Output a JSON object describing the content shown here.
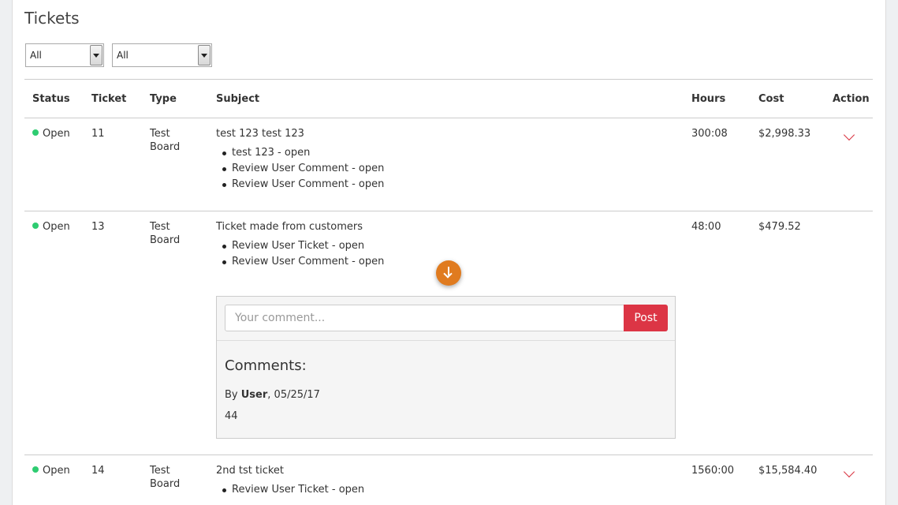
{
  "page_title": "Tickets",
  "filters": [
    {
      "value": "All"
    },
    {
      "value": "All"
    }
  ],
  "table": {
    "headers": [
      "Status",
      "Ticket",
      "Type",
      "Subject",
      "Hours",
      "Cost",
      "Action"
    ],
    "rows": [
      {
        "status": "Open",
        "ticket": "11",
        "type_line1": "Test",
        "type_line2": "Board",
        "subject": "test 123 test 123",
        "subitems": [
          "test 123 - open",
          "Review User Comment - open",
          "Review User Comment - open"
        ],
        "hours": "300:08",
        "cost": "$2,998.33",
        "action_icon": "chevron-down-icon"
      },
      {
        "status": "Open",
        "ticket": "13",
        "type_line1": "Test",
        "type_line2": "Board",
        "subject": "Ticket made from customers",
        "subitems": [
          "Review User Ticket - open",
          "Review User Comment - open"
        ],
        "hours": "48:00",
        "cost": "$479.52"
      },
      {
        "status": "Open",
        "ticket": "14",
        "type_line1": "Test",
        "type_line2": "Board",
        "subject": "2nd tst ticket",
        "subitems": [
          "Review User Ticket - open"
        ],
        "hours": "1560:00",
        "cost": "$15,584.40",
        "action_icon": "chevron-down-icon"
      }
    ]
  },
  "comments": {
    "placeholder": "Your comment...",
    "post_label": "Post",
    "heading": "Comments:",
    "entries": [
      {
        "by_prefix": "By ",
        "author": "User",
        "date_suffix": ", 05/25/17",
        "text": "44"
      }
    ]
  },
  "scroll_button_icon": "arrow-down-icon",
  "colors": {
    "status_open": "#2ecc71",
    "accent_red": "#dc3545",
    "fab_orange": "#e07b1f"
  }
}
